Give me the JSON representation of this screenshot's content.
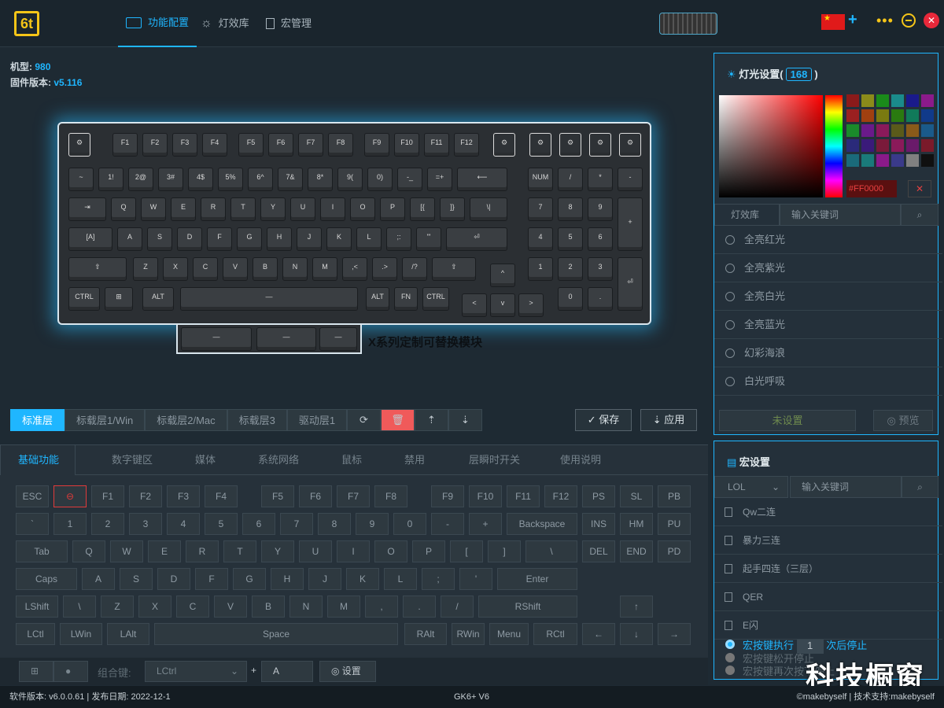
{
  "app": {
    "logo_text": "6t",
    "model_label": "机型:",
    "model_value": "980",
    "firmware_label": "固件版本:",
    "firmware_value": "v5.116"
  },
  "nav": [
    {
      "label": "功能配置",
      "active": true,
      "icon": "keyboard-icon"
    },
    {
      "label": "灯效库",
      "active": false,
      "icon": "sun-icon"
    },
    {
      "label": "宏管理",
      "active": false,
      "icon": "document-icon"
    }
  ],
  "window": {
    "flag": "★",
    "plus": "+",
    "more": "•••",
    "close": "✕"
  },
  "keyboard": {
    "fn_row": [
      "F1",
      "F2",
      "F3",
      "F4",
      "F5",
      "F6",
      "F7",
      "F8",
      "F9",
      "F10",
      "F11",
      "F12"
    ],
    "module_label": "X系列定制可替换模块"
  },
  "layers": [
    "标准层",
    "标载层1/Win",
    "标载层2/Mac",
    "标载层3",
    "驱动层1"
  ],
  "tools": {
    "refresh": "⟳",
    "delete": "🗑",
    "upload": "⇡",
    "download": "⇣"
  },
  "actions": {
    "save": "✓ 保存",
    "apply": "⇣ 应用"
  },
  "func_tabs": [
    "基础功能",
    "数字键区",
    "媒体",
    "系统网络",
    "鼠标",
    "禁用",
    "层瞬时开关",
    "使用说明"
  ],
  "base_keys": {
    "row1": [
      "ESC",
      "⊖",
      "F1",
      "F2",
      "F3",
      "F4",
      "F5",
      "F6",
      "F7",
      "F8",
      "F9",
      "F10",
      "F11",
      "F12",
      "PS",
      "SL",
      "PB"
    ],
    "row2": [
      "`",
      "1",
      "2",
      "3",
      "4",
      "5",
      "6",
      "7",
      "8",
      "9",
      "0",
      "-",
      "+",
      "Backspace",
      "INS",
      "HM",
      "PU"
    ],
    "row3": [
      "Tab",
      "Q",
      "W",
      "E",
      "R",
      "T",
      "Y",
      "U",
      "I",
      "O",
      "P",
      "[",
      "]",
      "\\",
      "DEL",
      "END",
      "PD"
    ],
    "row4": [
      "Caps",
      "A",
      "S",
      "D",
      "F",
      "G",
      "H",
      "J",
      "K",
      "L",
      ";",
      "'",
      "Enter"
    ],
    "row5": [
      "LShift",
      "\\",
      "Z",
      "X",
      "C",
      "V",
      "B",
      "N",
      "M",
      ",",
      ".",
      "/",
      "RShift",
      "↑"
    ],
    "row6": [
      "LCtl",
      "LWin",
      "LAlt",
      "Space",
      "RAlt",
      "RWin",
      "Menu",
      "RCtl",
      "←",
      "↓",
      "→"
    ]
  },
  "combo": {
    "label": "组合键:",
    "select_value": "LCtrl",
    "plus": "+",
    "key_value": "A",
    "set_button": "◎ 设置"
  },
  "light": {
    "title_prefix": "灯光设置(",
    "count": "168",
    "title_suffix": ")",
    "hex": "#FF0000",
    "library_tab": "灯效库",
    "search_placeholder": "输入关键词",
    "effects": [
      "全亮红光",
      "全亮紫光",
      "全亮白光",
      "全亮蓝光",
      "幻彩海浪",
      "白光呼吸"
    ],
    "unset_button": "未设置",
    "preview_button": "◎ 预览",
    "swatch_colors": [
      "#8b1a1a",
      "#8b8b1a",
      "#1a8b1a",
      "#1a8b8b",
      "#1a1a8b",
      "#8b1a8b",
      "#9b2020",
      "#a04010",
      "#7a7a10",
      "#2a7a10",
      "#107a5a",
      "#103a8a",
      "#1a8a2a",
      "#6a1a8a",
      "#8a1a5a",
      "#5a5a1a",
      "#8a5a1a",
      "#1a5a8a",
      "#2a2a7a",
      "#3a1a7a",
      "#7a1a3a",
      "#8a1a5a",
      "#6a1a6a",
      "#7a1a2a",
      "#1a6a7a",
      "#1a7a7a",
      "#8a1a8a",
      "#3a3a8a",
      "#808080",
      "#101010"
    ]
  },
  "macro": {
    "title": "宏设置",
    "game_select": "LOL",
    "search_placeholder": "输入关键词",
    "items": [
      "Qw二连",
      "暴力三连",
      "起手四连（三层）",
      "QER",
      "E闪"
    ],
    "exec_prefix": "宏按键执行",
    "exec_count": "1",
    "exec_suffix": "次后停止",
    "option2": "宏按键松开停止",
    "option3": "宏按键再次按下停止"
  },
  "status": {
    "version": "软件版本: v6.0.0.61 | 发布日期: 2022-12-1",
    "device": "GK6+ V6",
    "credit": "©makebyself | 技术支持:makebyself"
  },
  "watermark": "科技橱窗"
}
